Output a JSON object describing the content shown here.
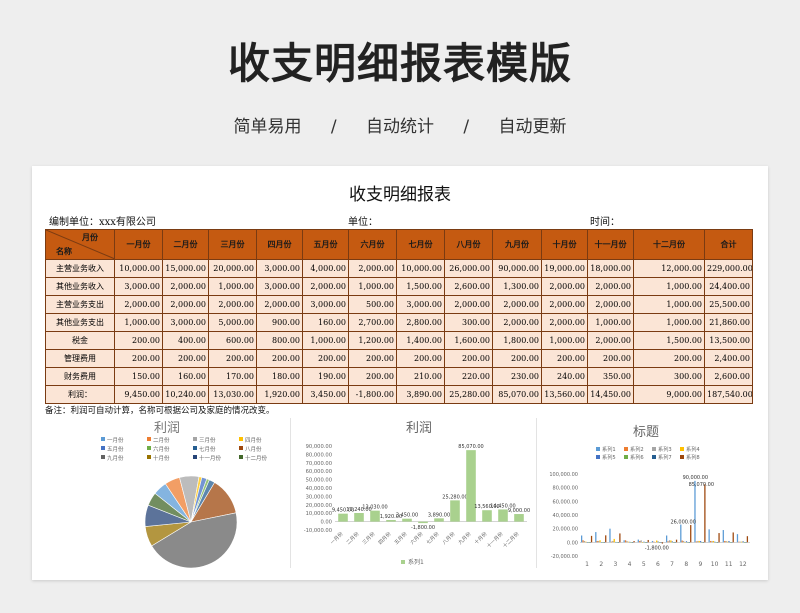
{
  "hero": {
    "title": "收支明细报表模版",
    "tags": [
      "简单易用",
      "自动统计",
      "自动更新"
    ],
    "sep": "/"
  },
  "sheet": {
    "title": "收支明细报表",
    "unit_label": "编制单位：xxx有限公司",
    "unit_field": "单位：",
    "time_field": "时间：",
    "corner_month": "月份",
    "corner_name": "名称",
    "months": [
      "一月份",
      "二月份",
      "三月份",
      "四月份",
      "五月份",
      "六月份",
      "七月份",
      "八月份",
      "九月份",
      "十月份",
      "十一月份",
      "十二月份",
      "合计"
    ],
    "rows": [
      {
        "name": "主营业务收入",
        "values": [
          "10,000.00",
          "15,000.00",
          "20,000.00",
          "3,000.00",
          "4,000.00",
          "2,000.00",
          "10,000.00",
          "26,000.00",
          "90,000.00",
          "19,000.00",
          "18,000.00",
          "12,000.00",
          "229,000.00"
        ]
      },
      {
        "name": "其他业务收入",
        "values": [
          "3,000.00",
          "2,000.00",
          "1,000.00",
          "3,000.00",
          "2,000.00",
          "1,000.00",
          "1,500.00",
          "2,600.00",
          "1,300.00",
          "2,000.00",
          "2,000.00",
          "1,000.00",
          "24,400.00"
        ]
      },
      {
        "name": "主营业务支出",
        "values": [
          "2,000.00",
          "2,000.00",
          "2,000.00",
          "2,000.00",
          "3,000.00",
          "500.00",
          "3,000.00",
          "2,000.00",
          "2,000.00",
          "2,000.00",
          "2,000.00",
          "1,000.00",
          "25,500.00"
        ]
      },
      {
        "name": "其他业务支出",
        "values": [
          "1,000.00",
          "3,000.00",
          "5,000.00",
          "900.00",
          "160.00",
          "2,700.00",
          "2,800.00",
          "300.00",
          "2,000.00",
          "2,000.00",
          "1,000.00",
          "1,000.00",
          "21,860.00"
        ]
      },
      {
        "name": "税金",
        "values": [
          "200.00",
          "400.00",
          "600.00",
          "800.00",
          "1,000.00",
          "1,200.00",
          "1,400.00",
          "1,600.00",
          "1,800.00",
          "1,000.00",
          "2,000.00",
          "1,500.00",
          "13,500.00"
        ]
      },
      {
        "name": "管理费用",
        "values": [
          "200.00",
          "200.00",
          "200.00",
          "200.00",
          "200.00",
          "200.00",
          "200.00",
          "200.00",
          "200.00",
          "200.00",
          "200.00",
          "200.00",
          "2,400.00"
        ]
      },
      {
        "name": "财务费用",
        "values": [
          "150.00",
          "160.00",
          "170.00",
          "180.00",
          "190.00",
          "200.00",
          "210.00",
          "220.00",
          "230.00",
          "240.00",
          "350.00",
          "300.00",
          "2,600.00"
        ]
      },
      {
        "name": "利润：",
        "values": [
          "9,450.00",
          "10,240.00",
          "13,030.00",
          "1,920.00",
          "3,450.00",
          "-1,800.00",
          "3,890.00",
          "25,280.00",
          "85,070.00",
          "13,560.00",
          "14,450.00",
          "9,000.00",
          "187,540.00"
        ]
      }
    ],
    "note": "备注：利润可自动计算，名称可根据公司及家庭的情况改变。"
  },
  "chart_data": [
    {
      "type": "pie",
      "title": "利润",
      "categories": [
        "一月份",
        "二月份",
        "三月份",
        "四月份",
        "五月份",
        "六月份",
        "七月份",
        "八月份",
        "九月份",
        "十月份",
        "十一月份",
        "十二月份"
      ],
      "values": [
        9450,
        10240,
        13030,
        1920,
        3450,
        -1800,
        3890,
        25280,
        85070,
        13560,
        14450,
        9000
      ],
      "colors": [
        "#5b9bd5",
        "#ed7d31",
        "#a5a5a5",
        "#ffc000",
        "#4472c4",
        "#70ad47",
        "#255e91",
        "#9e480e",
        "#636363",
        "#997300",
        "#264478",
        "#43682b"
      ]
    },
    {
      "type": "bar",
      "title": "利润",
      "categories": [
        "一月份",
        "二月份",
        "三月份",
        "四月份",
        "五月份",
        "六月份",
        "七月份",
        "八月份",
        "九月份",
        "十月份",
        "十一月份",
        "十二月份"
      ],
      "series": [
        {
          "name": "系列1",
          "values": [
            9450,
            10240,
            13030,
            1920,
            3450,
            -1800,
            3890,
            25280,
            85070,
            13560,
            14450,
            9000
          ]
        }
      ],
      "data_labels": [
        "9,450.00",
        "10,240.00",
        "13,030.00",
        "1,920.00",
        "3,450.00",
        "-1,800.00",
        "3,890.00",
        "25,280.00",
        "85,070.00",
        "13,560.00",
        "14,450.00",
        "9,000.00"
      ],
      "yticks": [
        "90,000.00",
        "80,000.00",
        "70,000.00",
        "60,000.00",
        "50,000.00",
        "40,000.00",
        "30,000.00",
        "20,000.00",
        "10,000.00",
        "0.00",
        "-10,000.00"
      ],
      "ylim": [
        -10000,
        90000
      ],
      "color": "#a9d18e"
    },
    {
      "type": "bar",
      "title": "标题",
      "categories": [
        "1",
        "2",
        "3",
        "4",
        "5",
        "6",
        "7",
        "8",
        "9",
        "10",
        "11",
        "12"
      ],
      "series": [
        {
          "name": "系列1",
          "values": [
            10000,
            3000,
            2000,
            1000,
            200,
            200,
            150,
            9450
          ]
        },
        {
          "name": "系列2",
          "values": [
            15000,
            2000,
            2000,
            3000,
            400,
            200,
            160,
            10240
          ]
        },
        {
          "name": "系列3",
          "values": [
            20000,
            1000,
            2000,
            5000,
            600,
            200,
            170,
            13030
          ]
        },
        {
          "name": "系列4",
          "values": [
            3000,
            3000,
            2000,
            900,
            800,
            200,
            180,
            1920
          ]
        },
        {
          "name": "系列5",
          "values": [
            4000,
            2000,
            3000,
            160,
            1000,
            200,
            190,
            3450
          ]
        },
        {
          "name": "系列6",
          "values": [
            2000,
            1000,
            500,
            2700,
            1200,
            200,
            200,
            -1800
          ]
        },
        {
          "name": "系列7",
          "values": [
            10000,
            1500,
            3000,
            2800,
            1400,
            200,
            210,
            3890
          ]
        },
        {
          "name": "系列8",
          "values": [
            26000,
            2600,
            2000,
            300,
            1600,
            200,
            220,
            25280
          ]
        }
      ],
      "colors": [
        "#5b9bd5",
        "#ed7d31",
        "#a5a5a5",
        "#ffc000",
        "#4472c4",
        "#70ad47",
        "#255e91",
        "#9e480e"
      ],
      "yticks": [
        "100,000.00",
        "80,000.00",
        "60,000.00",
        "40,000.00",
        "20,000.00",
        "0.00",
        "-20,000.00"
      ],
      "ylim": [
        -20000,
        100000
      ],
      "data_labels": [
        "90,000.00",
        "85,070.00",
        "26,000.00",
        "-1,800.00"
      ]
    }
  ]
}
